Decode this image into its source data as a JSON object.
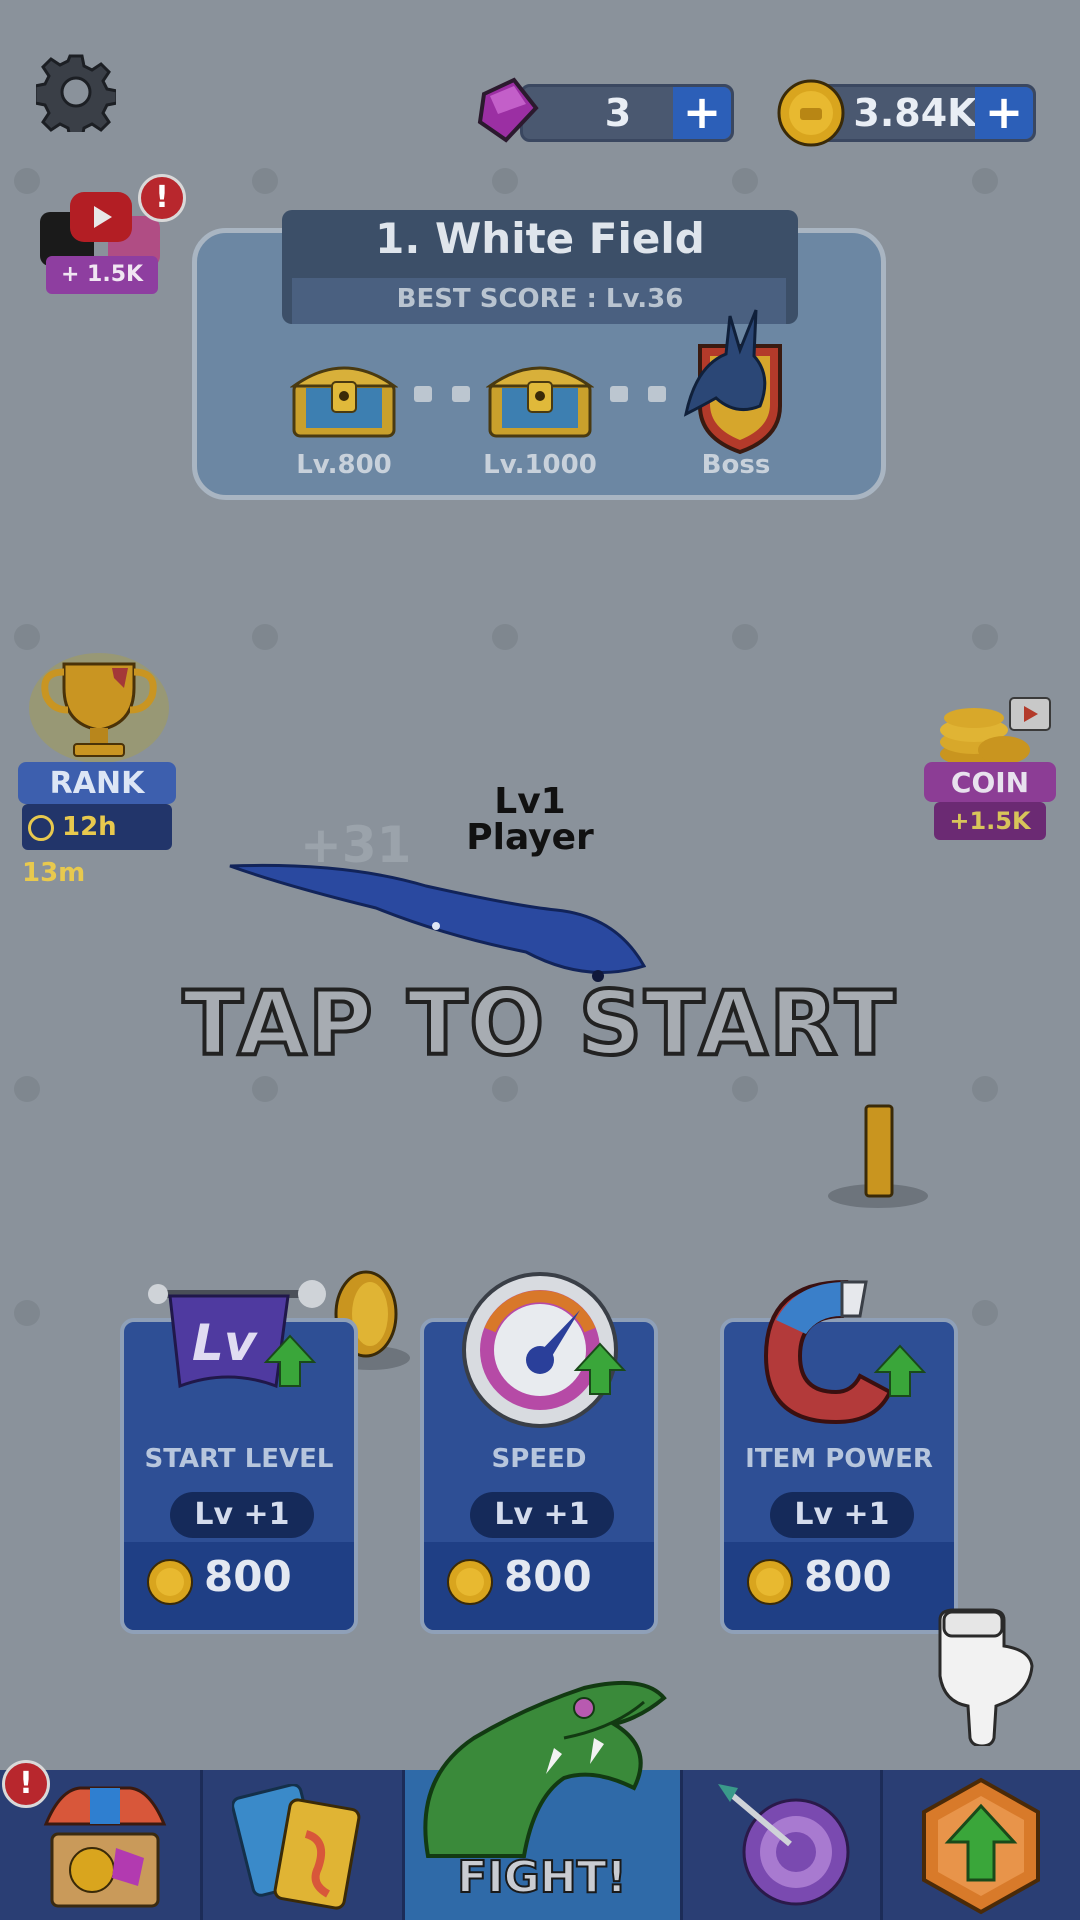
{
  "top": {
    "gems": {
      "value": "3",
      "plus": "+"
    },
    "coins": {
      "value": "3.84K",
      "plus": "+"
    }
  },
  "social": {
    "reward": "+ 1.5K",
    "alert": "!"
  },
  "level": {
    "title": "1. White Field",
    "best_score": "BEST SCORE : Lv.36",
    "milestones": [
      {
        "label": "Lv.800",
        "icon": "treasure-chest-icon"
      },
      {
        "label": "Lv.1000",
        "icon": "treasure-chest-icon"
      },
      {
        "label": "Boss",
        "icon": "dragon-boss-icon"
      }
    ]
  },
  "rank": {
    "label": "RANK",
    "timer": "12h 13m"
  },
  "coin_offer": {
    "label": "COIN",
    "bonus": "+1.5K"
  },
  "player": {
    "level": "Lv1",
    "name": "Player",
    "ghost_score": "+31"
  },
  "prompt": "TAP TO START",
  "upgrades": [
    {
      "name": "START LEVEL",
      "level": "Lv +1",
      "price": "800",
      "icon": "level-banner-icon"
    },
    {
      "name": "SPEED",
      "level": "Lv +1",
      "price": "800",
      "icon": "speedometer-icon"
    },
    {
      "name": "ITEM POWER",
      "level": "Lv +1",
      "price": "800",
      "icon": "magnet-icon"
    }
  ],
  "nav": {
    "shop_alert": "!",
    "fight": "FIGHT!",
    "items": [
      "shop-icon",
      "cards-icon",
      "snake-head-icon",
      "target-icon",
      "upgrade-hexagon-icon"
    ]
  },
  "colors": {
    "accent_blue": "#2e4f95",
    "gold": "#e8b930",
    "purple": "#8c3d95",
    "alert_red": "#b8272d"
  }
}
